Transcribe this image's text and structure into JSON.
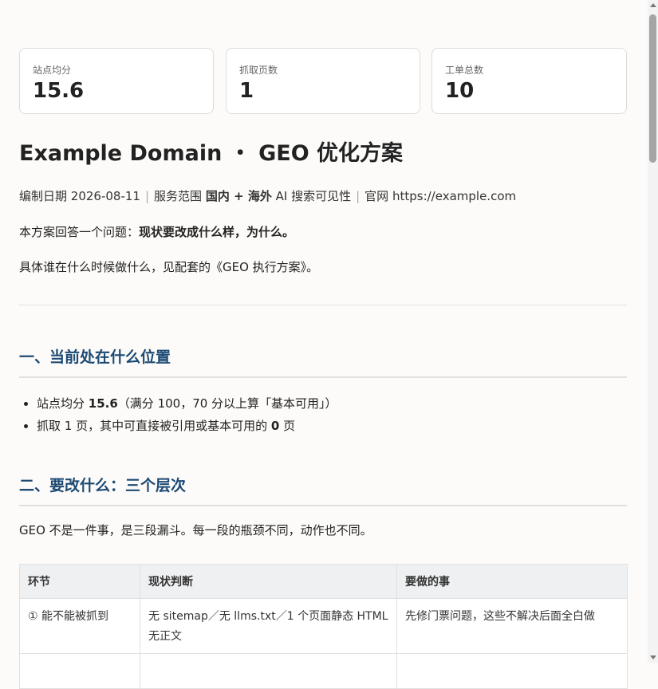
{
  "stats": [
    {
      "label": "站点均分",
      "value": "15.6"
    },
    {
      "label": "抓取页数",
      "value": "1"
    },
    {
      "label": "工单总数",
      "value": "10"
    }
  ],
  "title": "Example Domain ・ GEO 优化方案",
  "meta": {
    "date_label": "编制日期",
    "date": "2026-08-11",
    "scope_label": "服务范围",
    "scope_strong": "国内 + 海外",
    "scope_rest": "AI 搜索可见性",
    "site_label": "官网",
    "site": "https://example.com"
  },
  "intro": {
    "p1_lead": "本方案回答一个问题：",
    "p1_strong": "现状要改成什么样，为什么。",
    "p2": "具体谁在什么时候做什么，见配套的《GEO 执行方案》。"
  },
  "section1": {
    "heading": "一、当前处在什么位置",
    "b1_lead": "站点均分 ",
    "b1_strong": "15.6",
    "b1_rest": "（满分 100，70 分以上算「基本可用」）",
    "b2_lead": "抓取 1 页，其中可直接被引用或基本可用的 ",
    "b2_strong": "0",
    "b2_rest": " 页"
  },
  "section2": {
    "heading": "二、要改什么：三个层次",
    "para": "GEO 不是一件事，是三段漏斗。每一段的瓶颈不同，动作也不同。",
    "table": {
      "headers": [
        "环节",
        "现状判断",
        "要做的事"
      ],
      "rows": [
        [
          "① 能不能被抓到",
          "无 sitemap／无 llms.txt／1 个页面静态 HTML 无正文",
          "先修门票问题，这些不解决后面全白做"
        ]
      ]
    }
  }
}
